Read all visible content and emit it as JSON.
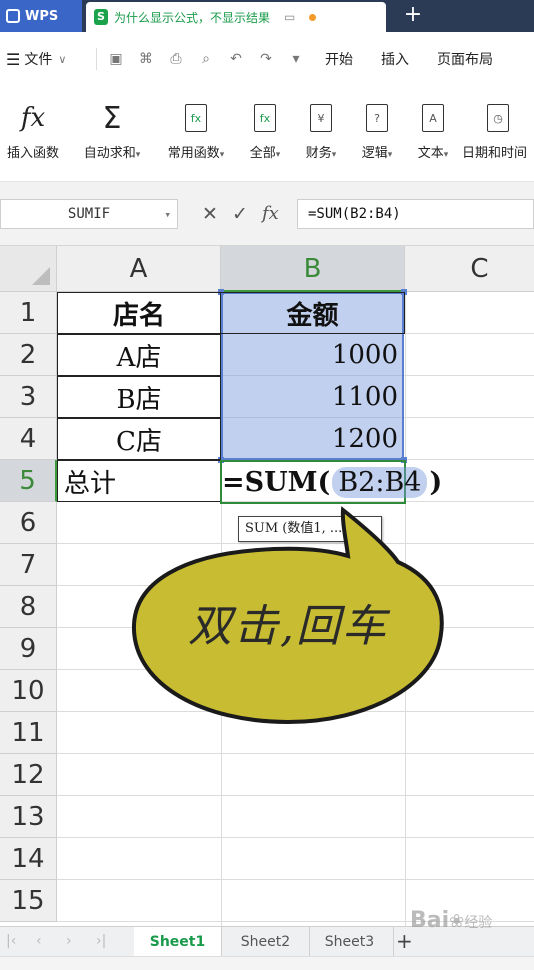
{
  "titlebar": {
    "app_name": "WPS",
    "doc_title": "为什么显示公式，不显示结果",
    "new_tab": "+"
  },
  "menubar": {
    "file_label": "文件",
    "tabs": [
      "开始",
      "插入",
      "页面布局"
    ]
  },
  "ribbon": {
    "buttons": [
      {
        "label": "插入函数",
        "icon": "fx"
      },
      {
        "label": "自动求和",
        "icon": "Σ"
      },
      {
        "label": "常用函数",
        "icon": "fx"
      },
      {
        "label": "全部",
        "icon": "fx"
      },
      {
        "label": "财务",
        "icon": "¥"
      },
      {
        "label": "逻辑",
        "icon": "?"
      },
      {
        "label": "文本",
        "icon": "A"
      },
      {
        "label": "日期和时间",
        "icon": "◷"
      }
    ]
  },
  "formula_bar": {
    "name_box": "SUMIF",
    "cancel": "✕",
    "confirm": "✓",
    "fx": "fx",
    "content": "=SUM(B2:B4)"
  },
  "grid": {
    "columns": [
      "A",
      "B",
      "C"
    ],
    "rows": [
      "1",
      "2",
      "3",
      "4",
      "5",
      "6",
      "7",
      "8",
      "9",
      "10",
      "11",
      "12",
      "13",
      "14",
      "15"
    ],
    "cells": {
      "A1": "店名",
      "B1": "金额",
      "A2": "A店",
      "B2": "1000",
      "A3": "B店",
      "B3": "1100",
      "A4": "C店",
      "B4": "1200",
      "A5": "总计"
    },
    "formula_prefix": "=SUM(",
    "formula_ref": "B2:B4",
    "formula_suffix": ")",
    "tooltip": "SUM (数值1, ...)"
  },
  "annotation": {
    "text": "双击,回车",
    "fill_color": "#c8bd32"
  },
  "sheet_tabs": {
    "tabs": [
      "Sheet1",
      "Sheet2",
      "Sheet3"
    ],
    "active": "Sheet1",
    "add": "+"
  },
  "watermark": {
    "brand": "Bai",
    "brand2": "经验"
  },
  "colors": {
    "wps_blue": "#3a66c8",
    "selection": "#5b7fd0",
    "active_green": "#2e8b3a"
  }
}
